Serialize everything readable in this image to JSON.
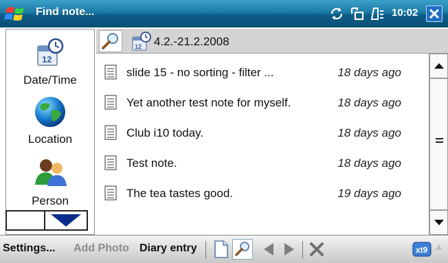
{
  "title_bar": {
    "app_title": "Find note...",
    "clock": "10:02",
    "icons": [
      "windows-start-icon",
      "sync-icon",
      "connectivity-icon",
      "phone-signal-icon",
      "close-icon"
    ]
  },
  "categories": [
    {
      "label": "Date/Time",
      "icon": "calendar-clock-icon"
    },
    {
      "label": "Location",
      "icon": "globe-icon"
    },
    {
      "label": "Person",
      "icon": "people-icon"
    }
  ],
  "filter": {
    "text": "4.2.-21.2.2008",
    "icons": [
      "search-icon",
      "calendar-clock-icon"
    ]
  },
  "notes": [
    {
      "title": "slide 15 - no sorting - filter ...",
      "age": "18 days ago"
    },
    {
      "title": "Yet another test note for myself.",
      "age": "18 days ago"
    },
    {
      "title": "Club i10 today.",
      "age": "18 days ago"
    },
    {
      "title": "Test note.",
      "age": "18 days ago"
    },
    {
      "title": "The tea tastes good.",
      "age": "19 days ago"
    }
  ],
  "menu_bar": {
    "settings_label": "Settings...",
    "add_photo_label": "Add Photo",
    "diary_entry_label": "Diary entry",
    "icons": [
      "new-note-icon",
      "search-icon",
      "arrow-left-icon",
      "arrow-right-icon",
      "delete-icon",
      "keyboard-icon"
    ]
  },
  "colors": {
    "title_bar": "#1c7aa6",
    "menu_disabled": "#8d8d8d",
    "accent_blue": "#1f6ec2"
  }
}
